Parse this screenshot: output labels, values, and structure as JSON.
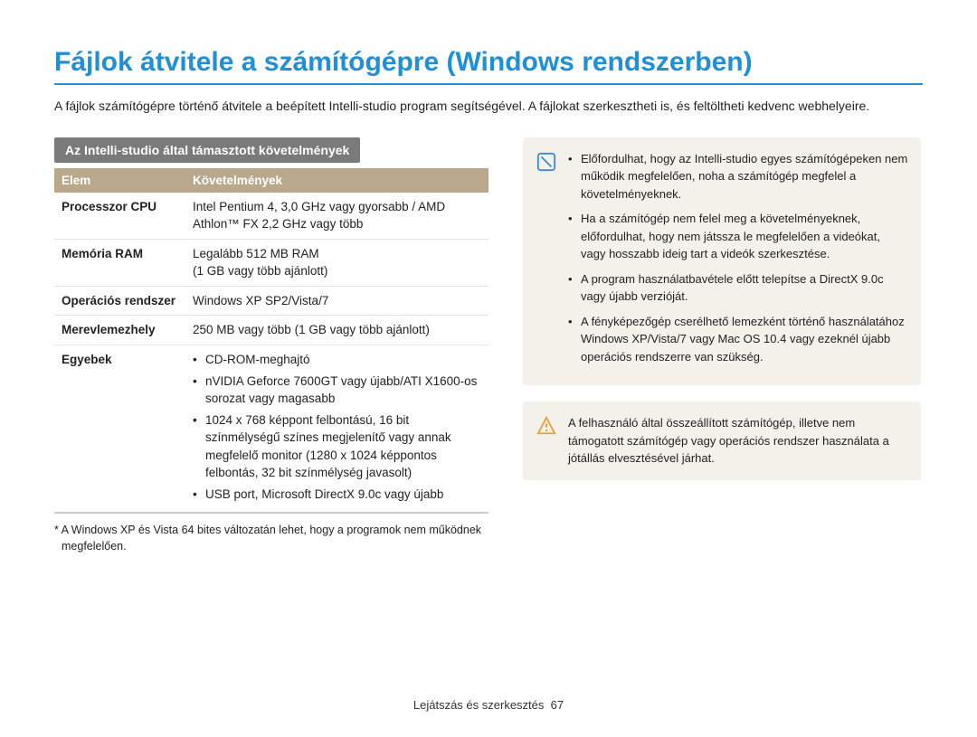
{
  "title": "Fájlok átvitele a számítógépre (Windows rendszerben)",
  "intro": "A fájlok számítógépre történő átvitele a beépített Intelli-studio program segítségével. A fájlokat szerkesztheti is, és feltöltheti kedvenc webhelyeire.",
  "section_heading": "Az Intelli-studio által támasztott követelmények",
  "table": {
    "head": {
      "c1": "Elem",
      "c2": "Követelmények"
    },
    "rows": [
      {
        "k": "Processzor CPU",
        "v": "Intel Pentium 4, 3,0 GHz vagy gyorsabb / AMD Athlon™ FX 2,2 GHz vagy több"
      },
      {
        "k": "Memória RAM",
        "v": "Legalább 512 MB RAM\n(1 GB vagy több ajánlott)"
      },
      {
        "k": "Operációs rendszer",
        "v": "Windows XP SP2/Vista/7"
      },
      {
        "k": "Merevlemezhely",
        "v": "250 MB vagy több (1 GB vagy több ajánlott)"
      }
    ],
    "last": {
      "k": "Egyebek",
      "items": [
        "CD-ROM-meghajtó",
        "nVIDIA Geforce 7600GT vagy újabb/ATI X1600-os sorozat vagy magasabb",
        "1024 x 768 képpont felbontású, 16 bit színmélységű színes megjelenítő vagy annak megfelelő monitor (1280 x 1024 képpontos felbontás, 32 bit színmélység javasolt)",
        "USB port, Microsoft DirectX 9.0c vagy újabb"
      ]
    }
  },
  "footnote": "* A Windows XP és Vista 64 bites változatán lehet, hogy a programok nem működnek megfelelően.",
  "info_box": {
    "items": [
      "Előfordulhat, hogy az Intelli-studio egyes számítógépeken nem működik megfelelően, noha a számítógép megfelel a követelményeknek.",
      "Ha a számítógép nem felel meg a követelményeknek, előfordulhat, hogy nem játssza le megfelelően a videókat, vagy hosszabb ideig tart a videók szerkesztése.",
      "A program használatbavétele előtt telepítse a DirectX 9.0c vagy újabb verzióját.",
      "A fényképezőgép cserélhető lemezként történő használatához Windows XP/Vista/7 vagy Mac OS 10.4 vagy ezeknél újabb operációs rendszerre van szükség."
    ]
  },
  "warn_box": {
    "text": "A felhasználó által összeállított számítógép, illetve nem támogatott számítógép vagy operációs rendszer használata a jótállás elvesztésével járhat."
  },
  "footer": {
    "section": "Lejátszás és szerkesztés",
    "page": "67"
  },
  "colors": {
    "accent": "#1f8fd6",
    "header_bg": "#b9a88c",
    "note_bg": "#f4f1eb",
    "warn": "#e9a23b",
    "info": "#3a8ccf"
  }
}
